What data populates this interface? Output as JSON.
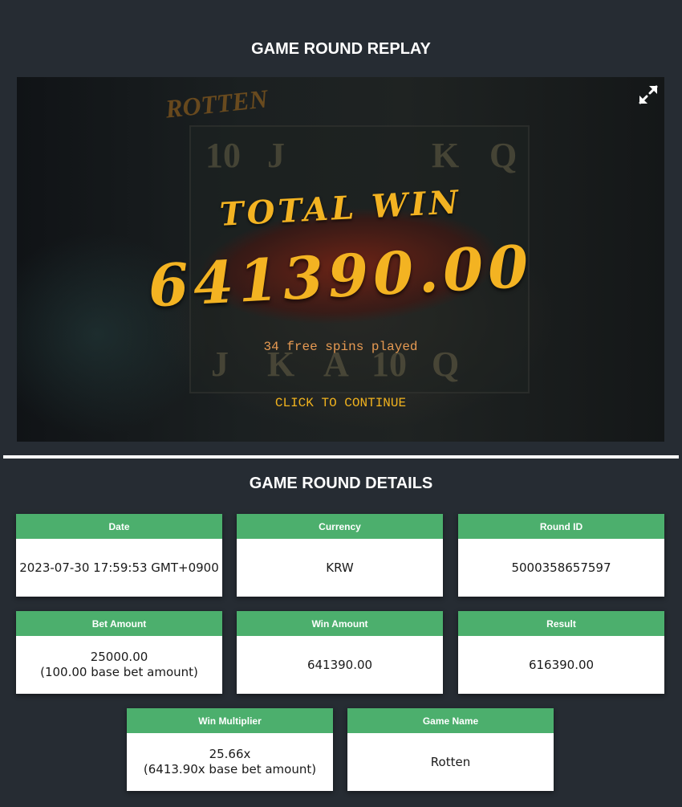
{
  "replay": {
    "title": "GAME ROUND REPLAY",
    "game_logo": "ROTTEN",
    "total_win_label": "TOTAL WIN",
    "total_win_amount": "641390.00",
    "free_spins_text": "34 free spins played",
    "continue_text": "CLICK TO CONTINUE",
    "fullscreen_icon": "expand-icon"
  },
  "details": {
    "title": "GAME ROUND DETAILS",
    "cards": [
      {
        "label": "Date",
        "value": "2023-07-30 17:59:53 GMT+0900",
        "sub": ""
      },
      {
        "label": "Currency",
        "value": "KRW",
        "sub": ""
      },
      {
        "label": "Round ID",
        "value": "5000358657597",
        "sub": ""
      },
      {
        "label": "Bet Amount",
        "value": "25000.00",
        "sub": "(100.00 base bet amount)"
      },
      {
        "label": "Win Amount",
        "value": "641390.00",
        "sub": ""
      },
      {
        "label": "Result",
        "value": "616390.00",
        "sub": ""
      },
      {
        "label": "Win Multiplier",
        "value": "25.66x",
        "sub": "(6413.90x base bet amount)"
      },
      {
        "label": "Game Name",
        "value": "Rotten",
        "sub": ""
      }
    ]
  },
  "colors": {
    "background": "#262c33",
    "header_green": "#4caf6d",
    "win_gold": "#f3b322"
  }
}
